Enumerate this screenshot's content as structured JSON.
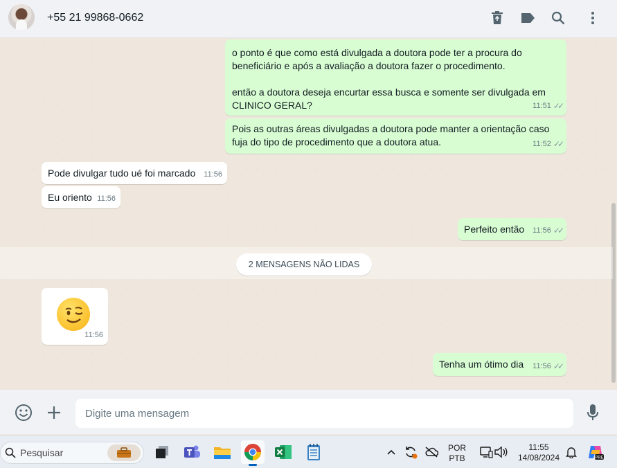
{
  "header": {
    "contact_name": "+55 21 99868-0662",
    "icons": [
      "delete-icon",
      "label-icon",
      "search-icon",
      "menu-icon"
    ]
  },
  "messages": [
    {
      "direction": "out",
      "text": "o ponto é que como está divulgada a doutora pode ter a procura do\nbeneficiário e após a avaliação a doutora fazer o procedimento.\n\nentão a doutora deseja encurtar essa busca e somente ser divulgada em\nCLINICO GERAL?",
      "time": "11:51",
      "status": "read"
    },
    {
      "direction": "out",
      "text": "Pois as outras áreas divulgadas a doutora pode manter a orientação caso\nfuja do tipo de procedimento que a doutora atua.",
      "time": "11:52",
      "status": "read"
    },
    {
      "direction": "in",
      "text": "Pode divulgar tudo ué foi marcado",
      "time": "11:56"
    },
    {
      "direction": "in",
      "text": "Eu oriento",
      "time": "11:56"
    },
    {
      "direction": "out",
      "text": "Perfeito então",
      "time": "11:56",
      "status": "read"
    },
    {
      "direction": "in",
      "emoji": "winking-face",
      "time": "11:56"
    },
    {
      "direction": "out",
      "text": "Tenha um ótimo dia",
      "time": "11:56",
      "status": "read"
    }
  ],
  "unread_divider": "2 MENSAGENS NÃO LIDAS",
  "composer": {
    "placeholder": "Digite uma mensagem",
    "icons": [
      "emoji-icon",
      "attach-plus-icon",
      "microphone-icon"
    ]
  },
  "taskbar": {
    "search_label": "Pesquisar",
    "apps": [
      "task-view-icon",
      "teams-icon",
      "file-explorer-icon",
      "chrome-icon",
      "excel-icon",
      "notepad-icon"
    ],
    "active_app": "chrome-icon",
    "language_line1": "POR",
    "language_line2": "PTB",
    "time": "11:55",
    "date": "14/08/2024"
  },
  "colors": {
    "outgoing_bubble": "#d9fdd3",
    "incoming_bubble": "#ffffff",
    "chat_background": "#efe7dd",
    "header_background": "#f0f2f5"
  }
}
